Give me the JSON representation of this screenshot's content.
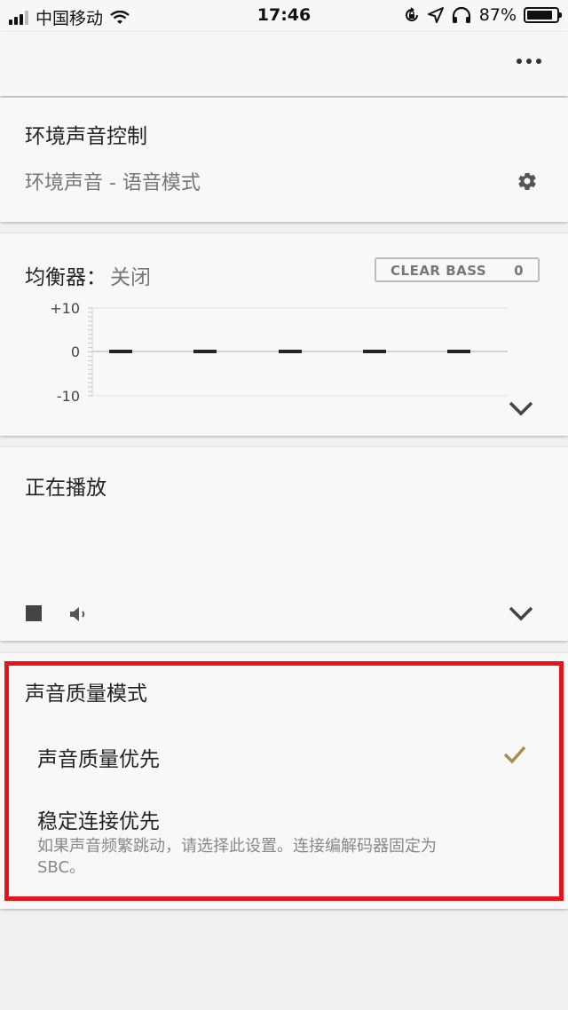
{
  "status_bar": {
    "carrier": "中国移动",
    "time": "17:46",
    "battery_percent": "87%",
    "battery_level": 0.87,
    "icons": [
      "signal-icon",
      "wifi-icon",
      "rotation-lock-icon",
      "location-icon",
      "headphones-icon",
      "battery-icon"
    ]
  },
  "header": {
    "more_icon": "more-horizontal-icon"
  },
  "ambient": {
    "title": "环境声音控制",
    "mode": "环境声音 - 语音模式",
    "settings_icon": "gear-icon"
  },
  "equalizer": {
    "title": "均衡器：",
    "value": "关闭",
    "clear_bass_label": "CLEAR BASS",
    "clear_bass_value": "0",
    "tick_top": "+10",
    "tick_mid": "0",
    "tick_bottom": "-10",
    "band_levels": [
      0,
      0,
      0,
      0,
      0
    ],
    "expand_icon": "chevron-down-icon"
  },
  "now_playing": {
    "title": "正在播放",
    "stop_icon": "stop-icon",
    "volume_icon": "speaker-icon",
    "expand_icon": "chevron-down-icon"
  },
  "sound_quality": {
    "title": "声音质量模式",
    "options": [
      {
        "label": "声音质量优先",
        "selected": true
      },
      {
        "label": "稳定连接优先",
        "selected": false,
        "description": "如果声音频繁跳动，请选择此设置。连接编解码器固定为SBC。"
      }
    ],
    "check_color": "#a98d4f",
    "highlight_color": "#e8141b"
  }
}
